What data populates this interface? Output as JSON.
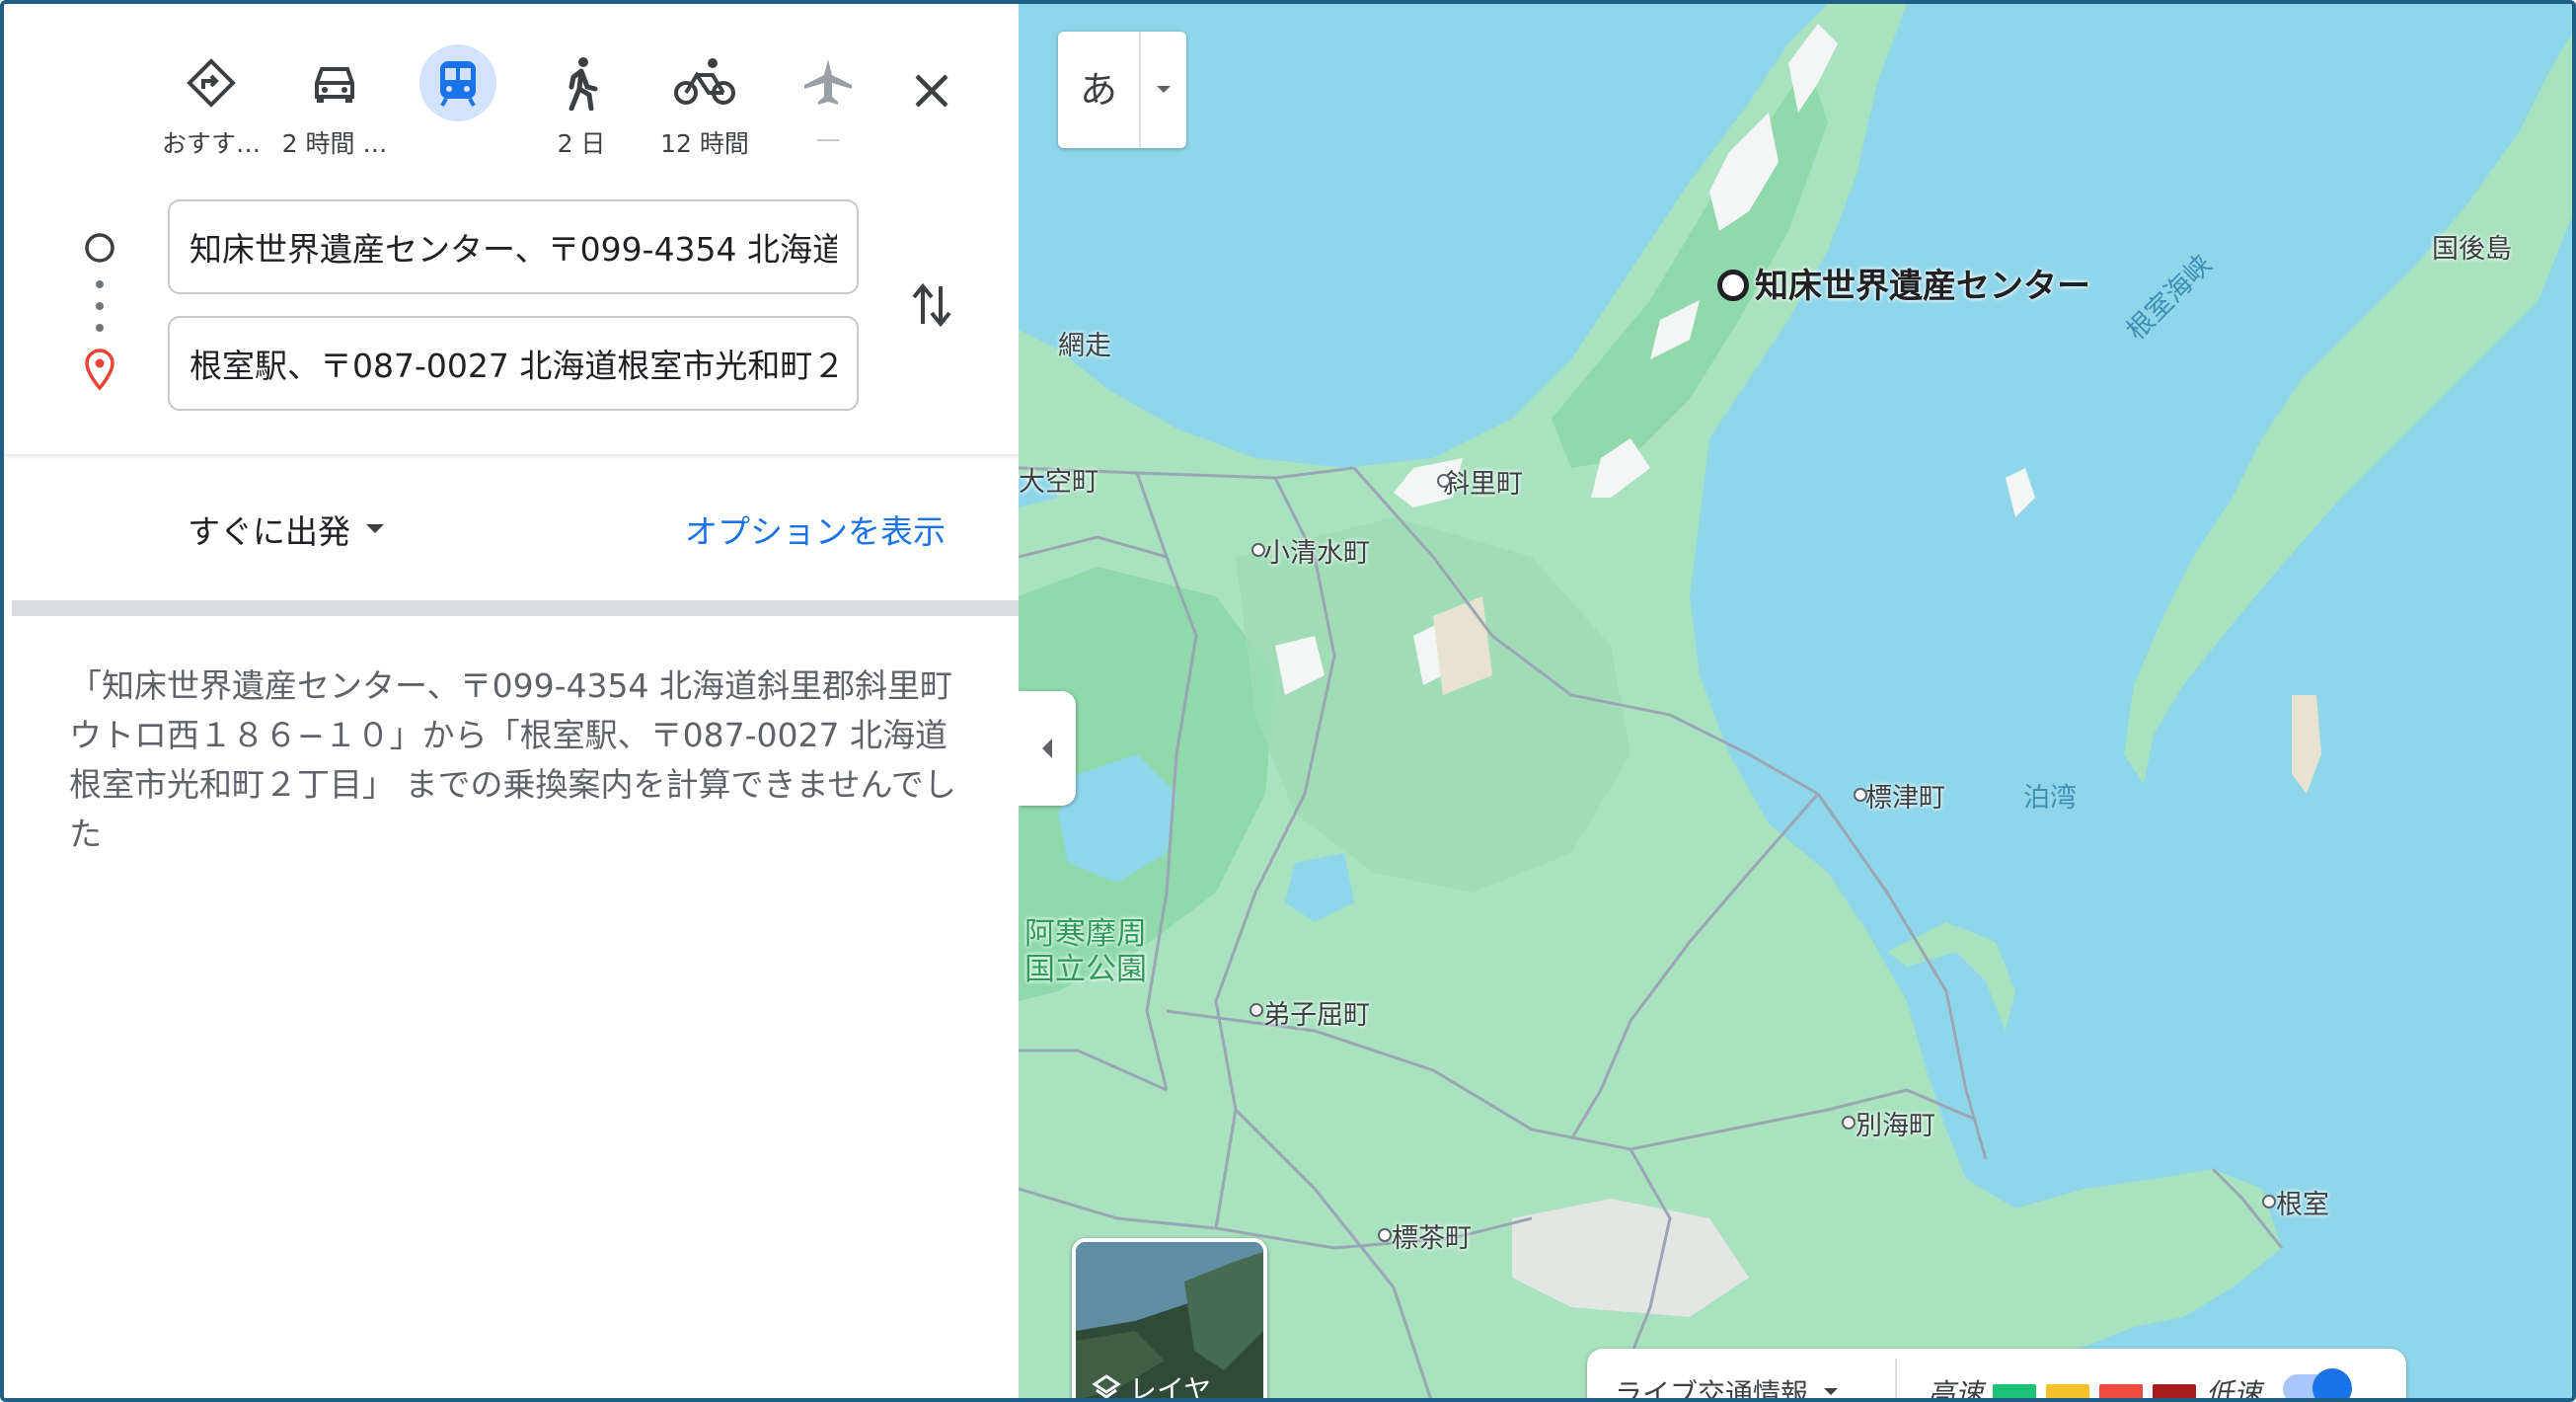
{
  "modes": [
    {
      "name": "best",
      "label": "おすす…"
    },
    {
      "name": "driving",
      "label": "2 時間 …"
    },
    {
      "name": "transit",
      "label": ""
    },
    {
      "name": "walking",
      "label": "2 日"
    },
    {
      "name": "cycling",
      "label": "12 時間"
    },
    {
      "name": "flights",
      "label": "—"
    }
  ],
  "origin": {
    "value": "知床世界遺産センター、〒099-4354 北海道斜里郡斜里町ウトロ西１８６−１０"
  },
  "destination": {
    "value": "根室駅、〒087-0027 北海道根室市光和町２丁目"
  },
  "depart": {
    "label": "すぐに出発"
  },
  "options": {
    "label": "オプションを表示"
  },
  "message": "「知床世界遺産センター、〒099-4354 北海道斜里郡斜里町ウトロ西１８６−１０」から「根室駅、〒087-0027 北海道根室市光和町２丁目」 までの乗換案内を計算できませんでした",
  "map": {
    "language_button": "あ",
    "labels": {
      "shiretoko": "知床世界遺産センター",
      "abashiri": "網走",
      "ozora": "大空町",
      "shari": "斜里町",
      "koshimizu": "小清水町",
      "shibetsu": "標津町",
      "akan": "阿寒摩周\n国立公園",
      "teshikaga": "弟子屈町",
      "betsukai": "別海町",
      "shibecha": "標茶町",
      "nemuro": "根室",
      "kunashiri": "国後島",
      "nemuro_strait": "根室海峡",
      "notsuke": "泊湾"
    },
    "layers_label": "レイヤ",
    "traffic": {
      "live": "ライブ交通情報",
      "fast": "高速",
      "slow": "低速"
    },
    "colors": {
      "water": "#8fd6ea",
      "land": "#a8e2be",
      "park": "#8fd9ab",
      "road": "#9aa6b5",
      "transit_active": "#1a73e8",
      "pin": "#ea4335"
    }
  }
}
